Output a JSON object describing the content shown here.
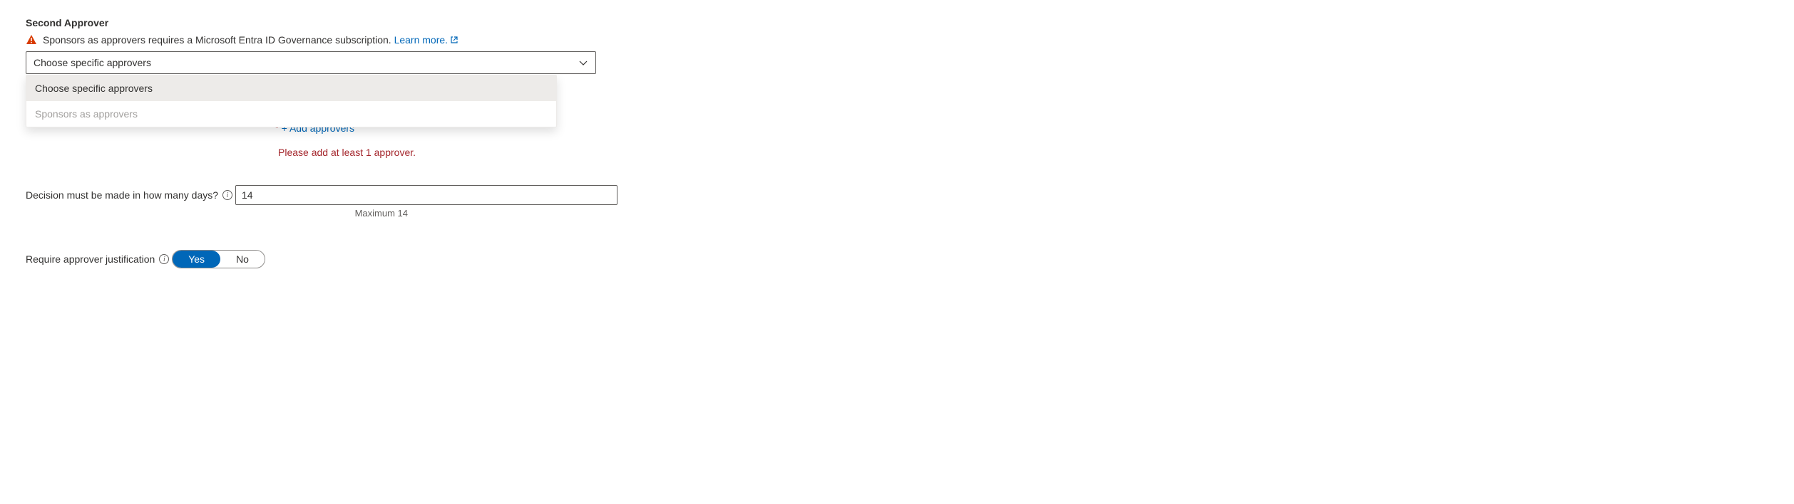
{
  "section": {
    "title": "Second Approver"
  },
  "banner": {
    "text": "Sponsors as approvers requires a Microsoft Entra ID Governance subscription. ",
    "learn_more": "Learn more."
  },
  "dropdown": {
    "value": "Choose specific approvers",
    "options": [
      {
        "label": "Choose specific approvers",
        "state": "selected"
      },
      {
        "label": "Sponsors as approvers",
        "state": "disabled"
      }
    ]
  },
  "add": {
    "star": "*",
    "label": "+ Add approvers"
  },
  "error": "Please add at least 1 approver.",
  "days": {
    "label": "Decision must be made in how many days?",
    "value": "14",
    "helper": "Maximum 14"
  },
  "justification": {
    "label": "Require approver justification",
    "yes": "Yes",
    "no": "No"
  }
}
